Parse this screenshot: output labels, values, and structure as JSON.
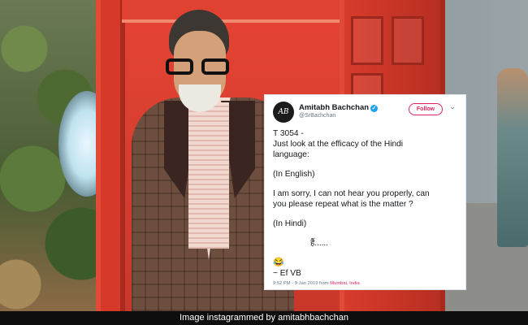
{
  "tweet": {
    "avatar_text": "AB",
    "name": "Amitabh Bachchan",
    "verified_icon": "verified-badge-icon",
    "handle": "@SrBachchan",
    "follow_label": "Follow",
    "body": {
      "id": "T 3054 -",
      "line1": "Just look at the efficacy of the Hindi",
      "line2": "language:",
      "english_label": "(In English)",
      "english_line1": "I am sorry, I can not hear you properly, can",
      "english_line2": "you please repeat what is the matter ?",
      "hindi_label": "(In Hindi)",
      "hindi_text": "हैं......",
      "emoji": "😂",
      "sign": "~ Ef VB"
    },
    "footer": {
      "datetime": "9:52 PM - 9 Jan 2019 from",
      "place": "Mumbai, India"
    }
  },
  "caption": "Image instagrammed by amitabhbachchan",
  "colors": {
    "booth": "#d6392a",
    "follow": "#e0245e",
    "verified": "#1da1f2"
  }
}
